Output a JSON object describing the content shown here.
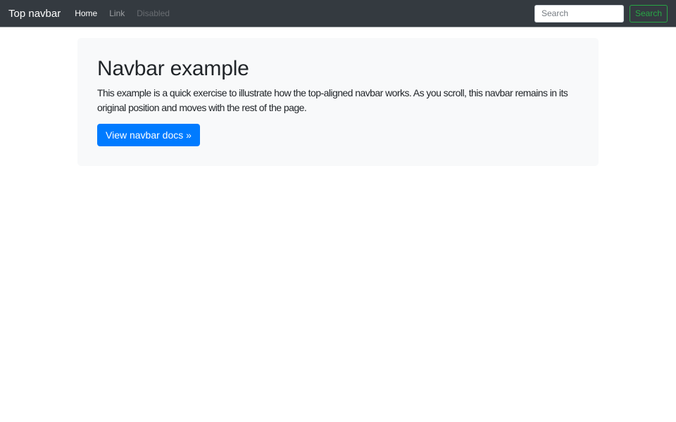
{
  "navbar": {
    "brand": "Top navbar",
    "links": [
      {
        "label": "Home",
        "state": "active"
      },
      {
        "label": "Link",
        "state": "default"
      },
      {
        "label": "Disabled",
        "state": "disabled"
      }
    ],
    "search": {
      "placeholder": "Search",
      "button_label": "Search"
    }
  },
  "main": {
    "title": "Navbar example",
    "description": "This example is a quick exercise to illustrate how the top-aligned navbar works. As you scroll, this navbar remains in its\noriginal position and moves with the rest of the page.",
    "cta_label": "View navbar docs »"
  },
  "colors": {
    "navbar_bg": "#343a40",
    "panel_bg": "#f8f9fa",
    "primary": "#007bff",
    "success": "#28a745",
    "text": "#212529"
  }
}
